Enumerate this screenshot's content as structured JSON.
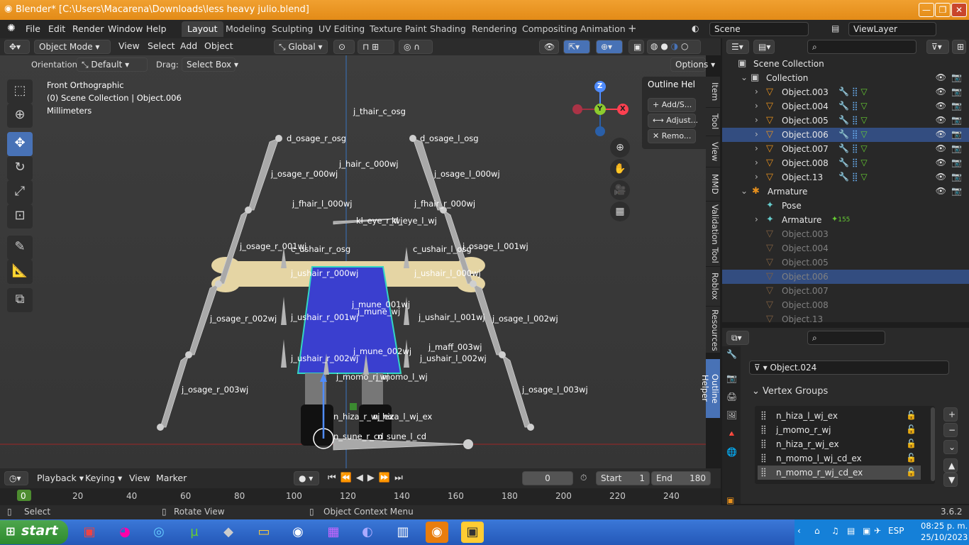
{
  "window": {
    "title": "Blender* [C:\\Users\\Macarena\\Downloads\\less heavy julio.blend]",
    "min": "—",
    "max": "❐",
    "close": "✕"
  },
  "menu": {
    "items": [
      "File",
      "Edit",
      "Render",
      "Window",
      "Help"
    ],
    "workspaces": [
      "Layout",
      "Modeling",
      "Sculpting",
      "UV Editing",
      "Texture Paint",
      "Shading",
      "Rendering",
      "Compositing",
      "Animation"
    ],
    "add_tab": "+",
    "scene": "Scene",
    "viewlayer": "ViewLayer"
  },
  "header3d": {
    "mode": "Object Mode",
    "menus": [
      "View",
      "Select",
      "Add",
      "Object"
    ],
    "orientation": "Global"
  },
  "toolsettings": {
    "orientation_label": "Orientation:",
    "orientation_value": "Default",
    "drag_label": "Drag:",
    "drag_value": "Select Box",
    "options": "Options"
  },
  "viewport": {
    "view_name": "Front Orthographic",
    "collection": "(0) Scene Collection | Object.006",
    "units": "Millimeters",
    "axis": {
      "z": "Z",
      "y": "Y",
      "x": "X"
    },
    "bone_labels": [
      {
        "t": "d_osage_r_osg"
      },
      {
        "t": "d_osage_l_osg"
      },
      {
        "t": "j_osage_r_000wj"
      },
      {
        "t": "j_osage_l_000wj"
      },
      {
        "t": "j_osage_r_001wj"
      },
      {
        "t": "j_osage_l_001wj"
      },
      {
        "t": "j_osage_r_002wj"
      },
      {
        "t": "j_osage_l_002wj"
      },
      {
        "t": "j_osage_r_003wj"
      },
      {
        "t": "j_osage_l_003wj"
      },
      {
        "t": "c_ushair_r_osg"
      },
      {
        "t": "c_ushair_l_osg"
      },
      {
        "t": "j_ushair_r_000wj"
      },
      {
        "t": "j_ushair_l_000wj"
      },
      {
        "t": "j_ushair_r_001wj"
      },
      {
        "t": "j_ushair_l_001wj"
      },
      {
        "t": "j_ushair_r_002wj"
      },
      {
        "t": "j_ushair_l_002wj"
      },
      {
        "t": "j_momo_r_wj"
      },
      {
        "t": "j_momo_l_wj"
      },
      {
        "t": "n_hiza_r_wj_ex"
      },
      {
        "t": "n_hiza_l_wj_ex"
      },
      {
        "t": "j_maff_003wj"
      },
      {
        "t": "kl_eye_r_wj"
      },
      {
        "t": "kl_eye_l_wj"
      },
      {
        "t": "j_mune_wj"
      },
      {
        "t": "j_thair_c_osg"
      },
      {
        "t": "j_fhair_l_000wj"
      },
      {
        "t": "j_fhair_r_000wj"
      },
      {
        "t": "j_hair_c_000wj"
      },
      {
        "t": "j_mune_001wj"
      },
      {
        "t": "n_sune_r_cd"
      },
      {
        "t": "n_sune_l_cd"
      },
      {
        "t": "j_mune_002wj"
      }
    ]
  },
  "sidebar_tabs": [
    "Item",
    "Tool",
    "View",
    "MMD",
    "Validation Tool",
    "Roblox",
    "Resources",
    "Outline Helper"
  ],
  "outline_helper": {
    "title": "Outline Hel",
    "buttons": [
      "Add/S...",
      "Adjust...",
      "Remo..."
    ]
  },
  "outliner": {
    "scene_collection": "Scene Collection",
    "collection": "Collection",
    "objects": [
      "Object.003",
      "Object.004",
      "Object.005",
      "Object.006",
      "Object.007",
      "Object.008",
      "Object.13"
    ],
    "selected": "Object.006",
    "armature": "Armature",
    "pose": "Pose",
    "armature_data": "Armature",
    "bone_count": "155",
    "children": [
      "Object.003",
      "Object.004",
      "Object.005",
      "Object.006",
      "Object.007",
      "Object.008",
      "Object.13"
    ]
  },
  "properties": {
    "object": "Object.024",
    "panel": "Vertex Groups",
    "vertex_groups": [
      "n_hiza_l_wj_ex",
      "j_momo_r_wj",
      "n_hiza_r_wj_ex",
      "n_momo_l_wj_cd_ex",
      "n_momo_r_wj_cd_ex"
    ],
    "selected_group": "n_momo_r_wj_cd_ex"
  },
  "timeline": {
    "menus": [
      "Playback",
      "Keying",
      "View",
      "Marker"
    ],
    "current_frame": "0",
    "start_label": "Start",
    "start": "1",
    "end_label": "End",
    "end": "180",
    "ticks": [
      "0",
      "20",
      "40",
      "60",
      "80",
      "100",
      "120",
      "140",
      "160",
      "180",
      "200",
      "220",
      "240"
    ]
  },
  "status": {
    "left": "Select",
    "middle": "Rotate View",
    "right": "Object Context Menu",
    "version": "3.6.2"
  },
  "taskbar": {
    "start": "start",
    "lang": "ESP",
    "time": "08:25 p. m.",
    "date": "25/10/2023"
  },
  "colors": {
    "accent": "#4872b6",
    "title_orange": "#e8911d",
    "selected_row": "#334d80"
  }
}
